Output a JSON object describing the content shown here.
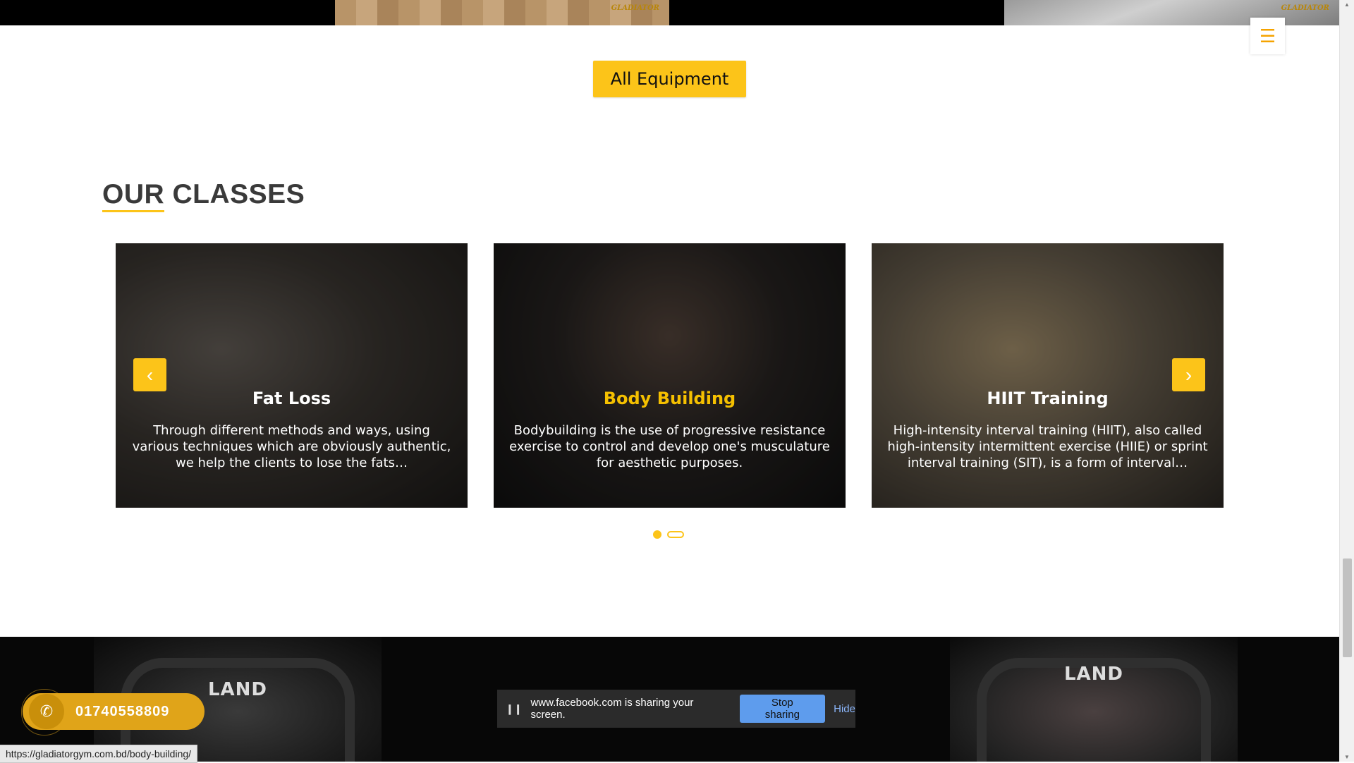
{
  "top": {
    "logo_text": "GLADIATOR"
  },
  "menu": {
    "hamburger_glyph": "☰"
  },
  "equipment": {
    "all_button_label": "All Equipment"
  },
  "classes": {
    "section_title": "OUR CLASSES",
    "items": [
      {
        "title": "Fat Loss",
        "description": "Through different methods and ways, using various techniques which are obviously authentic, we help the clients to lose the fats…"
      },
      {
        "title": "Body Building",
        "description": "Bodybuilding is the use of progressive resistance exercise to control and develop one's musculature for aesthetic purposes."
      },
      {
        "title": "HIIT Training",
        "description": "High-intensity interval training (HIIT), also called high-intensity intermittent exercise (HIIE) or sprint interval training (SIT), is a form of interval…"
      }
    ],
    "prev_glyph": "‹",
    "next_glyph": "›",
    "pagination": {
      "active_index": 0,
      "total": 2
    }
  },
  "bottom": {
    "machine_brand": "LAND"
  },
  "call": {
    "phone_glyph": "✆",
    "number": "01740558809"
  },
  "status_bar": {
    "url": "https://gladiatorgym.com.bd/body-building/"
  },
  "screen_share": {
    "pause_glyph": "❙❙",
    "message": "www.facebook.com is sharing your screen.",
    "stop_label": "Stop sharing",
    "hide_label": "Hide"
  },
  "colors": {
    "accent": "#fcc419",
    "active_title": "#f5c000",
    "share_button": "#5e9ced"
  }
}
